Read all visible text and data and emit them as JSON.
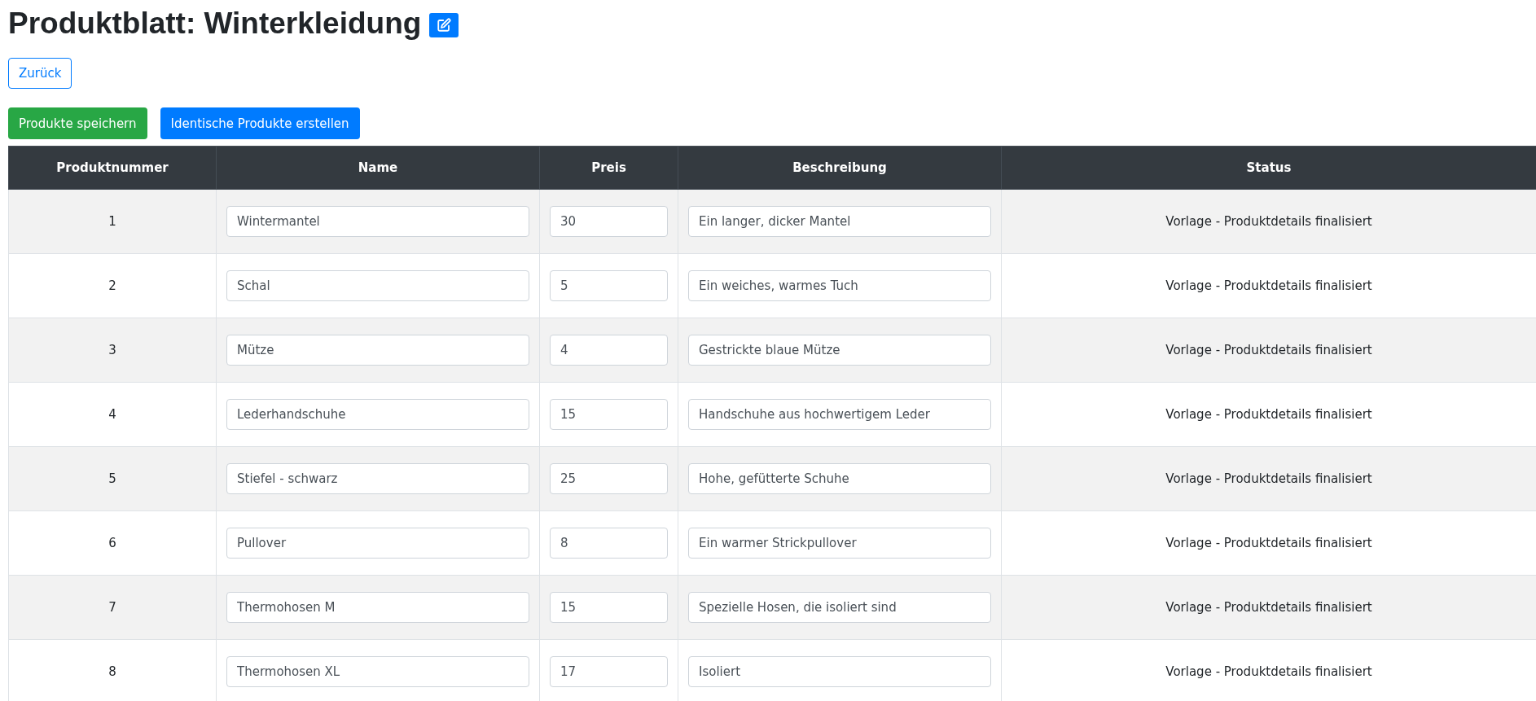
{
  "title": "Produktblatt: Winterkleidung",
  "back_button": "Zurück",
  "actions": [
    {
      "label": "Produkte speichern",
      "kind": "success"
    },
    {
      "label": "Identische Produkte erstellen",
      "kind": "primary"
    }
  ],
  "table": {
    "columns": [
      "Produktnummer",
      "Name",
      "Preis",
      "Beschreibung",
      "Status"
    ],
    "rows": [
      {
        "number": "1",
        "name": "Wintermantel",
        "price": "30",
        "description": "Ein langer, dicker Mantel",
        "status": "Vorlage - Produktdetails finalisiert"
      },
      {
        "number": "2",
        "name": "Schal",
        "price": "5",
        "description": "Ein weiches, warmes Tuch",
        "status": "Vorlage - Produktdetails finalisiert"
      },
      {
        "number": "3",
        "name": "Mütze",
        "price": "4",
        "description": "Gestrickte blaue Mütze",
        "status": "Vorlage - Produktdetails finalisiert"
      },
      {
        "number": "4",
        "name": "Lederhandschuhe",
        "price": "15",
        "description": "Handschuhe aus hochwertigem Leder",
        "status": "Vorlage - Produktdetails finalisiert"
      },
      {
        "number": "5",
        "name": "Stiefel - schwarz",
        "price": "25",
        "description": "Hohe, gefütterte Schuhe",
        "status": "Vorlage - Produktdetails finalisiert"
      },
      {
        "number": "6",
        "name": "Pullover",
        "price": "8",
        "description": "Ein warmer Strickpullover",
        "status": "Vorlage - Produktdetails finalisiert"
      },
      {
        "number": "7",
        "name": "Thermohosen M",
        "price": "15",
        "description": "Spezielle Hosen, die isoliert sind",
        "status": "Vorlage - Produktdetails finalisiert"
      },
      {
        "number": "8",
        "name": "Thermohosen XL",
        "price": "17",
        "description": "Isoliert",
        "status": "Vorlage - Produktdetails finalisiert"
      }
    ]
  }
}
